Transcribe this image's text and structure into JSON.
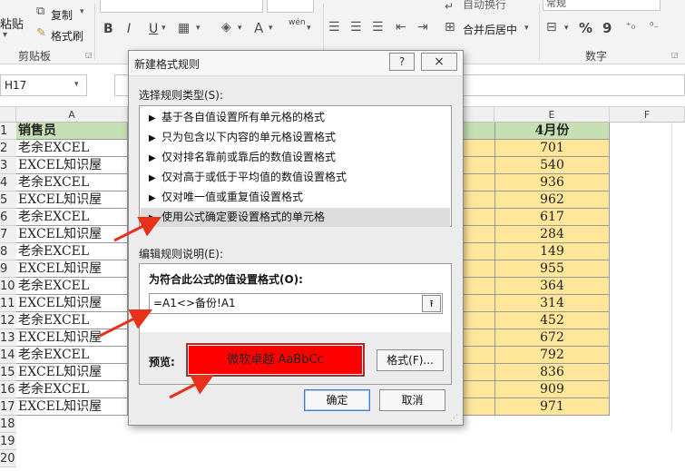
{
  "ribbon": {
    "paste_label": "粘贴",
    "copy_label": "复制",
    "format_painter_label": "格式刷",
    "clipboard_group": "剪贴板",
    "bold_label": "B",
    "italic_label": "I",
    "underline_label": "U",
    "merge_label": "合并后居中",
    "wrap_label": "自动换行",
    "number_format_value": "常规",
    "percent_label": "%",
    "comma_label": "9",
    "number_group": "数字",
    "wen_label": "wén"
  },
  "formula_bar": {
    "name_box": "H17"
  },
  "grid": {
    "columns": [
      "A",
      "E",
      "F"
    ],
    "header_a": "销售员",
    "header_e": "4月份",
    "rows": [
      {
        "num": "1",
        "a": "",
        "e": ""
      },
      {
        "num": "2",
        "a": "老余EXCEL",
        "e": "701"
      },
      {
        "num": "3",
        "a": "EXCEL知识屋",
        "e": "540"
      },
      {
        "num": "4",
        "a": "老余EXCEL",
        "e": "936"
      },
      {
        "num": "5",
        "a": "EXCEL知识屋",
        "e": "962"
      },
      {
        "num": "6",
        "a": "老余EXCEL",
        "e": "617"
      },
      {
        "num": "7",
        "a": "EXCEL知识屋",
        "e": "284"
      },
      {
        "num": "8",
        "a": "老余EXCEL",
        "e": "149"
      },
      {
        "num": "9",
        "a": "EXCEL知识屋",
        "e": "955"
      },
      {
        "num": "10",
        "a": "老余EXCEL",
        "e": "364"
      },
      {
        "num": "11",
        "a": "EXCEL知识屋",
        "e": "314"
      },
      {
        "num": "12",
        "a": "老余EXCEL",
        "e": "452"
      },
      {
        "num": "13",
        "a": "EXCEL知识屋",
        "e": "672"
      },
      {
        "num": "14",
        "a": "老余EXCEL",
        "e": "792"
      },
      {
        "num": "15",
        "a": "EXCEL知识屋",
        "e": "836"
      },
      {
        "num": "16",
        "a": "老余EXCEL",
        "e": "909"
      },
      {
        "num": "17",
        "a": "EXCEL知识屋",
        "e": "971"
      },
      {
        "num": "18",
        "a": "",
        "e": ""
      },
      {
        "num": "19",
        "a": "",
        "e": ""
      },
      {
        "num": "20",
        "a": "",
        "e": ""
      }
    ]
  },
  "dialog": {
    "title": "新建格式规则",
    "help_label": "?",
    "close_label": "×",
    "rule_type_label": "选择规则类型(S):",
    "rule_types": [
      "基于各自值设置所有单元格的格式",
      "只为包含以下内容的单元格设置格式",
      "仅对排名靠前或靠后的数值设置格式",
      "仅对高于或低于平均值的数值设置格式",
      "仅对唯一值或重复值设置格式",
      "使用公式确定要设置格式的单元格"
    ],
    "selected_index": 5,
    "edit_label": "编辑规则说明(E):",
    "formula_caption": "为符合此公式的值设置格式(O):",
    "formula_value": "=A1<>备份!A1",
    "collapse_label": "⭱",
    "preview_label": "预览:",
    "preview_text": "微软卓越 AaBbCc",
    "preview_fill": "#ff0000",
    "format_button": "格式(F)...",
    "ok_button": "确定",
    "cancel_button": "取消"
  },
  "colors": {
    "header_green": "#c6e0b4",
    "data_yellow": "#ffe699",
    "arrow_red": "#e8301a"
  }
}
